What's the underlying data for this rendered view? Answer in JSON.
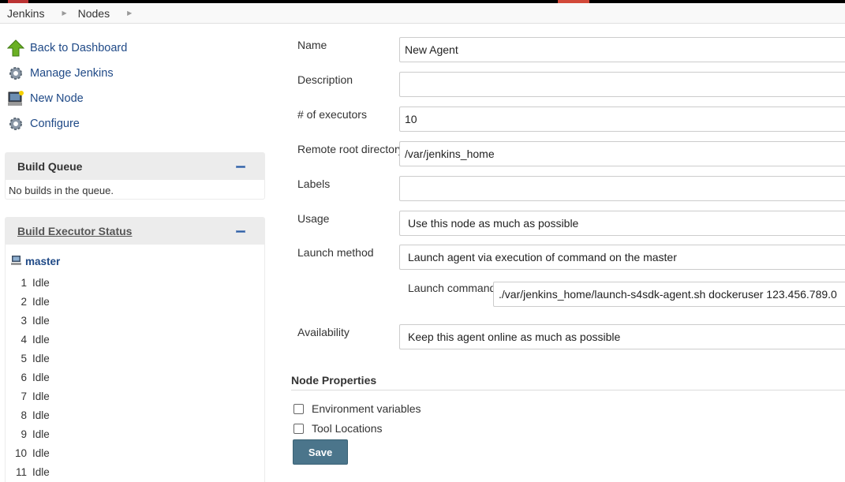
{
  "breadcrumb": [
    "Jenkins",
    "Nodes"
  ],
  "tasks": [
    {
      "label": "Back to Dashboard",
      "icon": "arrow-up-icon"
    },
    {
      "label": "Manage Jenkins",
      "icon": "gear-icon"
    },
    {
      "label": "New Node",
      "icon": "computer-icon"
    },
    {
      "label": "Configure",
      "icon": "gear-icon"
    }
  ],
  "build_queue": {
    "title": "Build Queue",
    "empty_text": "No builds in the queue."
  },
  "executor_status": {
    "title": "Build Executor Status",
    "node": "master",
    "executors": [
      {
        "num": "1",
        "status": "Idle"
      },
      {
        "num": "2",
        "status": "Idle"
      },
      {
        "num": "3",
        "status": "Idle"
      },
      {
        "num": "4",
        "status": "Idle"
      },
      {
        "num": "5",
        "status": "Idle"
      },
      {
        "num": "6",
        "status": "Idle"
      },
      {
        "num": "7",
        "status": "Idle"
      },
      {
        "num": "8",
        "status": "Idle"
      },
      {
        "num": "9",
        "status": "Idle"
      },
      {
        "num": "10",
        "status": "Idle"
      },
      {
        "num": "11",
        "status": "Idle"
      }
    ]
  },
  "form": {
    "name": {
      "label": "Name",
      "value": "New Agent"
    },
    "description": {
      "label": "Description",
      "value": ""
    },
    "executors": {
      "label": "# of executors",
      "value": "10"
    },
    "remote_root": {
      "label": "Remote root directory",
      "value": "/var/jenkins_home"
    },
    "labels": {
      "label": "Labels",
      "value": ""
    },
    "usage": {
      "label": "Usage",
      "value": "Use this node as much as possible"
    },
    "launch_method": {
      "label": "Launch method",
      "value": "Launch agent via execution of command on the master"
    },
    "launch_command": {
      "label": "Launch command",
      "value": "./var/jenkins_home/launch-s4sdk-agent.sh dockeruser 123.456.789.0"
    },
    "availability": {
      "label": "Availability",
      "value": "Keep this agent online as much as possible"
    }
  },
  "node_properties": {
    "title": "Node Properties",
    "options": [
      {
        "label": "Environment variables",
        "checked": false
      },
      {
        "label": "Tool Locations",
        "checked": false
      }
    ]
  },
  "save_label": "Save",
  "colors": {
    "link": "#204a87",
    "save_button": "#4b758b",
    "pane_header": "#ececec"
  }
}
